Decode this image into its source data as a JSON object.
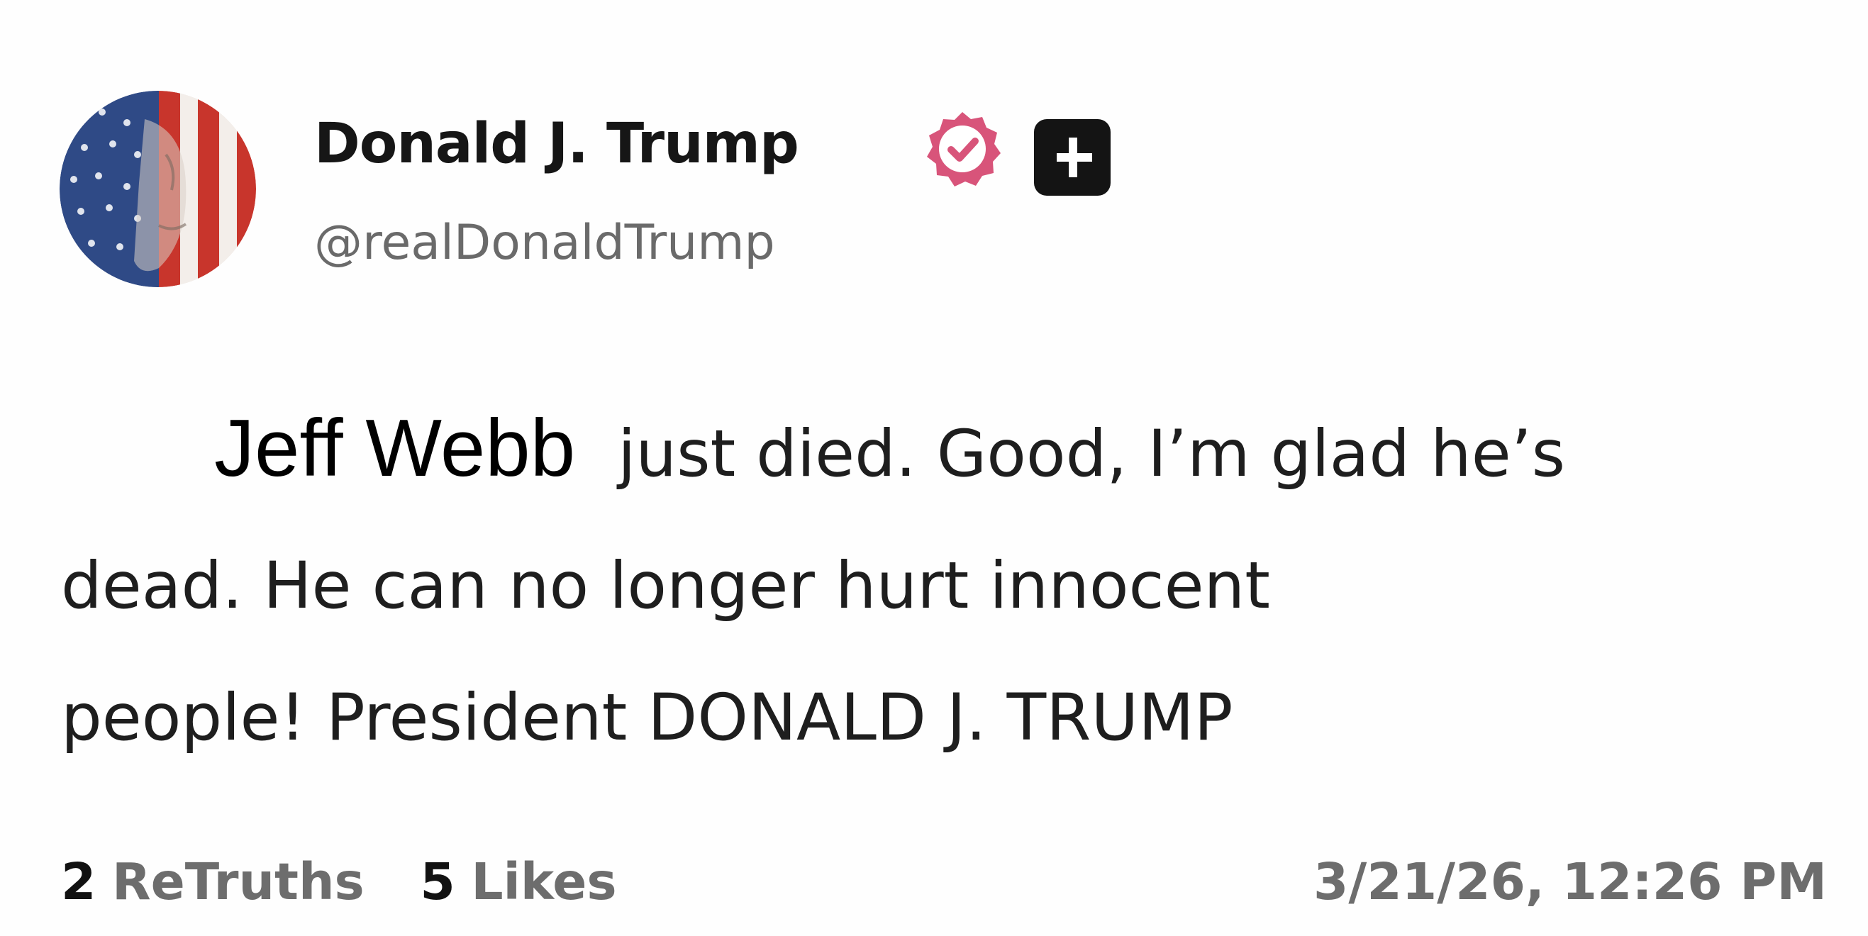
{
  "post": {
    "author": {
      "display_name": "Donald J. Trump",
      "handle": "@realDonaldTrump",
      "verified": true,
      "badge_color": "#d8547a"
    },
    "body": {
      "overlay_name": "Jeff Webb",
      "line1_rest": "just died. Good, I’m glad he’s",
      "line2": "dead. He can no longer hurt innocent",
      "line3": "people! President DONALD J. TRUMP"
    },
    "stats": {
      "retruths_count": "2",
      "retruths_label": "ReTruths",
      "likes_count": "5",
      "likes_label": "Likes"
    },
    "timestamp": "3/21/26, 12:26 PM"
  },
  "icons": {
    "avatar": "flag-portrait-avatar",
    "verified": "verified-check-icon",
    "plus": "plus-badge-icon"
  }
}
